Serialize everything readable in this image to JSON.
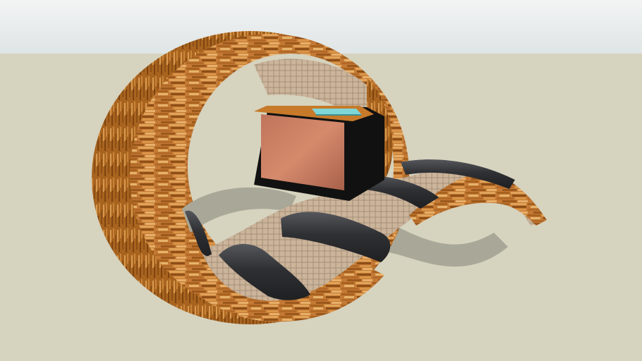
{
  "scene": {
    "subject": "",
    "colors": {
      "sky_top": "#f2f4f4",
      "sky_bottom": "#dfe4e4",
      "ground": "#d6d3bf",
      "shadow": "#a9a898",
      "wood_dark": "#9a5a1e",
      "wood_mid": "#c47a35",
      "wood_light": "#e2a55c",
      "wicker": "#cbb49a",
      "wicker_line": "#9a8670",
      "cushion": "#2f3033",
      "cushion_hi": "#55575c",
      "tv_frame": "#111111",
      "tv_screen": "#c87a5e",
      "tv_top": "#c77a2a",
      "book": "#7fd6d6"
    }
  }
}
